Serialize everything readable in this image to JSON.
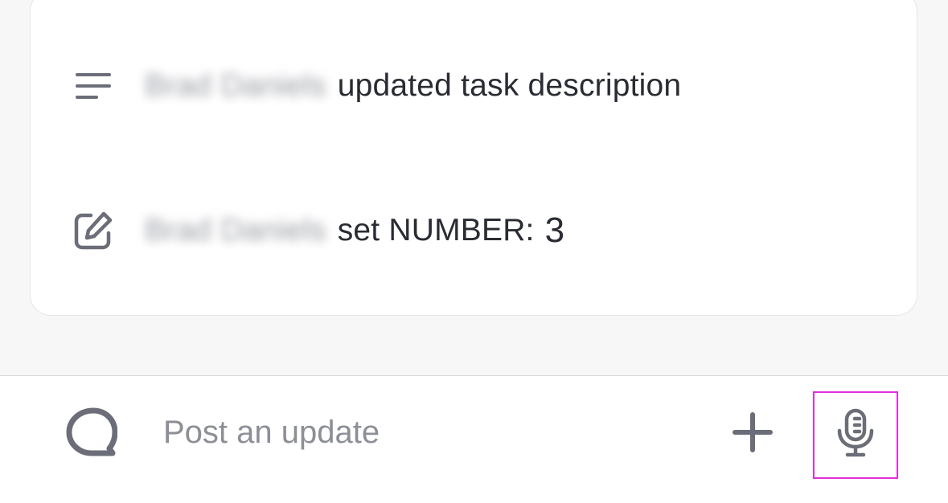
{
  "activity": {
    "items": [
      {
        "icon": "text-lines-icon",
        "actor": "Brad Daniels",
        "action": "updated task description",
        "value": ""
      },
      {
        "icon": "edit-icon",
        "actor": "Brad Daniels",
        "action": "set NUMBER:",
        "value": "3"
      }
    ]
  },
  "composer": {
    "placeholder": "Post an update",
    "avatar_icon": "chat-bubble-icon",
    "add_icon": "plus-icon",
    "mic_icon": "microphone-icon",
    "highlight_color": "#e22ee2"
  },
  "colors": {
    "text": "#2a2c33",
    "icon": "#6b6e78",
    "background": "#f7f7f8",
    "card": "#ffffff"
  }
}
